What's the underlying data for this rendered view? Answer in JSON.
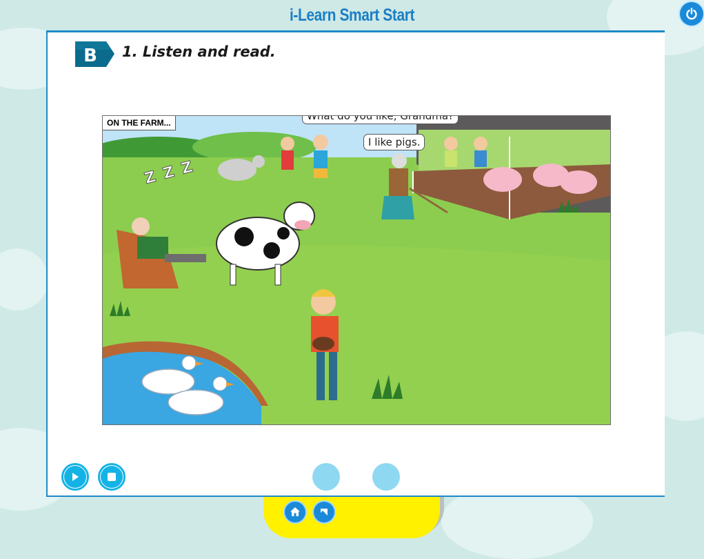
{
  "app": {
    "title": "i-Learn Smart Start"
  },
  "section": {
    "badge": "B",
    "title": "1. Listen and read."
  },
  "scene": {
    "label": "ON THE FARM...",
    "speech_1": "What do you like, Grandma?",
    "speech_2": "I like pigs.",
    "sleep_text": "Z Z Z"
  },
  "controls": {
    "play": "play-icon",
    "stop": "stop-icon",
    "home": "home-icon",
    "back": "back-icon",
    "power": "power-icon"
  },
  "colors": {
    "accent": "#1a8ad8",
    "frame": "#1d89c9",
    "light_button": "#8fd8f2",
    "nav_tab": "#fff100"
  }
}
